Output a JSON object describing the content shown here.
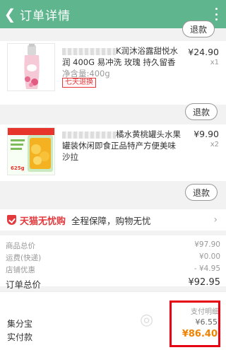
{
  "header": {
    "title": "订单详情"
  },
  "refund_label": "退款",
  "products": [
    {
      "name_visible": "K润沐浴露甜悦水润 400G 易冲洗 玫瑰 持久留香",
      "spec": "净含量:400g",
      "price": "¥24.90",
      "qty": "x1",
      "badge": "七天退换"
    },
    {
      "name_visible": "橘水黄桃罐头水果罐装休闲即食正品特产方便美味沙拉",
      "price": "¥9.90",
      "qty": "x2",
      "thumb_text": "625g"
    }
  ],
  "tmall": {
    "brand": "天猫无忧购",
    "desc": "全程保障，购物无忧"
  },
  "summary": {
    "rows": [
      {
        "label": "商品总价",
        "value": "¥97.90"
      },
      {
        "label": "运费(快递)",
        "value": "¥0.00"
      },
      {
        "label": "店铺优惠",
        "value": "- ¥4.95"
      }
    ],
    "total_label": "订单总价",
    "total_value": "¥92.95"
  },
  "payment": {
    "detail_label": "支付明细",
    "jifenbao_label": "集分宝",
    "jifenbao_value": "¥6.55",
    "paid_label": "实付款",
    "paid_value": "¥86.40"
  },
  "colors": {
    "header_bg": "#5fb58d",
    "accent_red": "#e4393c",
    "paid_orange": "#f08200",
    "highlight_red": "#e60012"
  }
}
